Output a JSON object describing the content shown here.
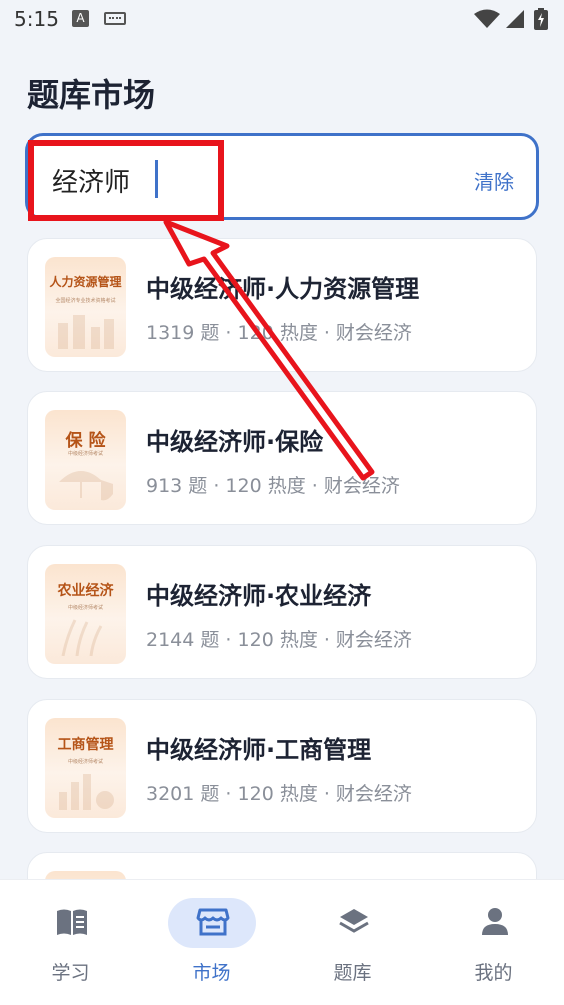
{
  "status_bar": {
    "time": "5:15",
    "notif_letter": "A"
  },
  "page": {
    "title": "题库市场"
  },
  "search": {
    "value": "经济师",
    "clear_label": "清除"
  },
  "items": [
    {
      "cover_title": "人力资源管理",
      "cover_sub": "全国经济专业技术资格考试",
      "title": "中级经济师·人力资源管理",
      "meta": "1319 题 · 120 热度 · 财会经济"
    },
    {
      "cover_title": "保 险",
      "cover_sub": "中级经济师考试",
      "title": "中级经济师·保险",
      "meta": "913 题 · 120 热度 · 财会经济"
    },
    {
      "cover_title": "农业经济",
      "cover_sub": "中级经济师考试",
      "title": "中级经济师·农业经济",
      "meta": "2144 题 · 120 热度 · 财会经济"
    },
    {
      "cover_title": "工商管理",
      "cover_sub": "中级经济师考试",
      "title": "中级经济师·工商管理",
      "meta": "3201 题 · 120 热度 · 财会经济"
    }
  ],
  "nav": [
    {
      "label": "学习",
      "icon": "book-icon",
      "active": false
    },
    {
      "label": "市场",
      "icon": "store-icon",
      "active": true
    },
    {
      "label": "题库",
      "icon": "layers-icon",
      "active": false
    },
    {
      "label": "我的",
      "icon": "person-icon",
      "active": false
    }
  ],
  "colors": {
    "accent": "#3f72c9",
    "annotation": "#e8141c"
  }
}
